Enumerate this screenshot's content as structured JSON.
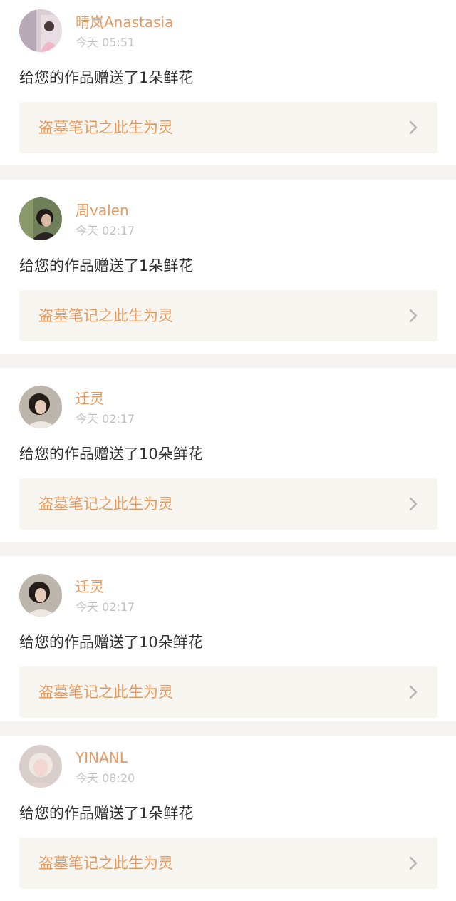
{
  "notifications": [
    {
      "user": "晴岚Anastasia",
      "time": "今天 05:51",
      "message": "给您的作品赠送了1朵鲜花",
      "book": "盗墓笔记之此生为灵",
      "avatar_icon": "user-photo-avatar"
    },
    {
      "user": "周valen",
      "time": "今天 02:17",
      "message": "给您的作品赠送了1朵鲜花",
      "book": "盗墓笔记之此生为灵",
      "avatar_icon": "user-photo-avatar"
    },
    {
      "user": "迁灵",
      "time": "今天 02:17",
      "message": "给您的作品赠送了10朵鲜花",
      "book": "盗墓笔记之此生为灵",
      "avatar_icon": "user-photo-avatar"
    },
    {
      "user": "迁灵",
      "time": "今天 02:17",
      "message": "给您的作品赠送了10朵鲜花",
      "book": "盗墓笔记之此生为灵",
      "avatar_icon": "user-photo-avatar"
    },
    {
      "user": "YINANL",
      "time": "今天 08:20",
      "message": "给您的作品赠送了1朵鲜花",
      "book": "盗墓笔记之此生为灵",
      "avatar_icon": "user-photo-avatar"
    }
  ],
  "colors": {
    "accent": "#e79a5f",
    "text": "#333333",
    "muted": "#c2c2c2",
    "link_background": "#f6f5ef",
    "separator": "#f5f4f2"
  },
  "icons": {
    "chevron": "chevron-right-icon"
  }
}
